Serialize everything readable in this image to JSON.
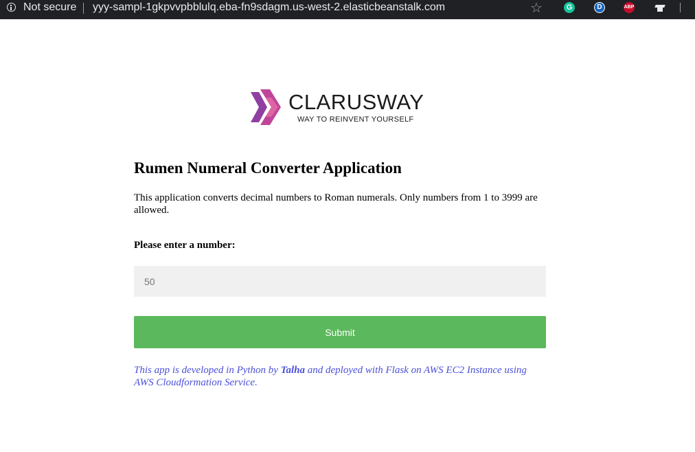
{
  "browser": {
    "security_label": "Not secure",
    "url": "yyy-sampl-1gkpvvpbblulq.eba-fn9sdagm.us-west-2.elasticbeanstalk.com",
    "extensions": [
      {
        "name": "grammarly-icon",
        "label": "G"
      },
      {
        "name": "d-extension-icon",
        "label": "D"
      },
      {
        "name": "adblock-plus-icon",
        "label": "ABP"
      }
    ]
  },
  "logo": {
    "wordmark": "CLARUSWAY",
    "tagline": "WAY TO REINVENT YOURSELF",
    "colors": [
      "#8e3fa0",
      "#c0459a",
      "#e26ba4"
    ]
  },
  "page": {
    "title": "Rumen Numeral Converter Application",
    "description": "This application converts decimal numbers to Roman numerals. Only numbers from 1 to 3999 are allowed.",
    "input_label": "Please enter a number:",
    "input_placeholder": "50",
    "submit_label": "Submit",
    "footer": {
      "part1": "This app is developed in Python by ",
      "author": "Talha",
      "part2": " and deployed with Flask on AWS EC2 Instance using AWS Cloudformation Service."
    }
  },
  "colors": {
    "submit": "#5cb85c",
    "footer_text": "#4a50d8",
    "input_bg": "#f0f0f0"
  }
}
